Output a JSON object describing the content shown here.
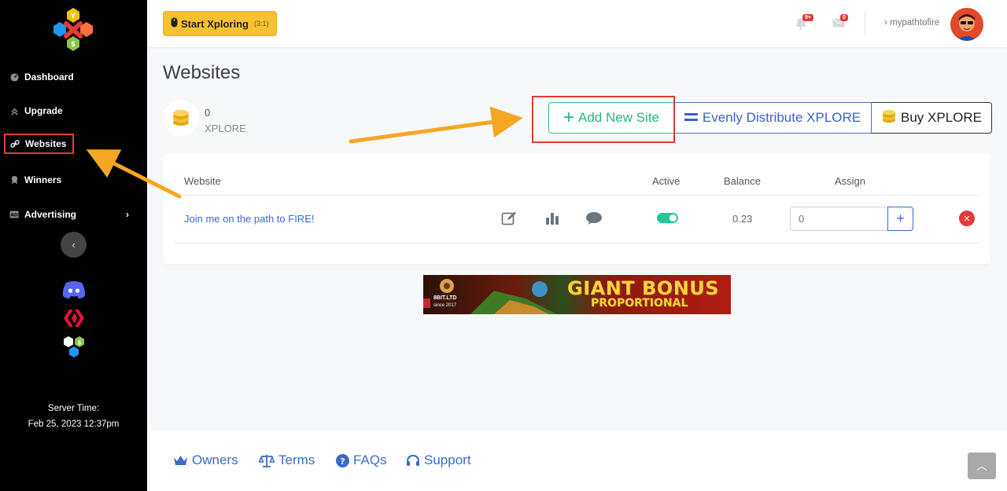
{
  "sidebar": {
    "items": [
      {
        "label": "Dashboard",
        "icon": "dashboard-icon"
      },
      {
        "label": "Upgrade",
        "icon": "upgrade-icon"
      },
      {
        "label": "Websites",
        "icon": "link-icon"
      },
      {
        "label": "Winners",
        "icon": "award-icon"
      },
      {
        "label": "Advertising",
        "icon": "ad-icon"
      }
    ],
    "server_time_label": "Server Time:",
    "server_time_value": "Feb 25, 2023 12:37pm"
  },
  "topbar": {
    "start_label": "Start Xploring",
    "start_ratio": "(3:1)",
    "notifications_badge": "9+",
    "messages_badge": "0",
    "username": "mypathtofire"
  },
  "main": {
    "title": "Websites",
    "balance": "0",
    "balance_unit": "XPLORE",
    "buttons": {
      "add": "Add New Site",
      "distribute": "Evenly Distribute XPLORE",
      "buy": "Buy XPLORE"
    },
    "table": {
      "headers": [
        "Website",
        "Active",
        "Balance",
        "Assign"
      ],
      "rows": [
        {
          "website": "Join me on the path to FIRE!",
          "active": true,
          "balance": "0.23",
          "assign": "0"
        }
      ]
    },
    "banner": {
      "title": "GIANT BONUS",
      "subtitle": "PROPORTIONAL",
      "brand": "8BIT.LTD",
      "since": "since 2017"
    }
  },
  "footer": {
    "links": [
      "Owners",
      "Terms",
      "FAQs",
      "Support"
    ]
  },
  "colors": {
    "sidebar_bg": "#000000",
    "start_button": "#f7c12f",
    "add_button": "#26b584",
    "distribute_button": "#3a5fcf",
    "link": "#3a6bc9",
    "highlight_box": "#e53935",
    "annotation_arrow": "#f5a623"
  }
}
